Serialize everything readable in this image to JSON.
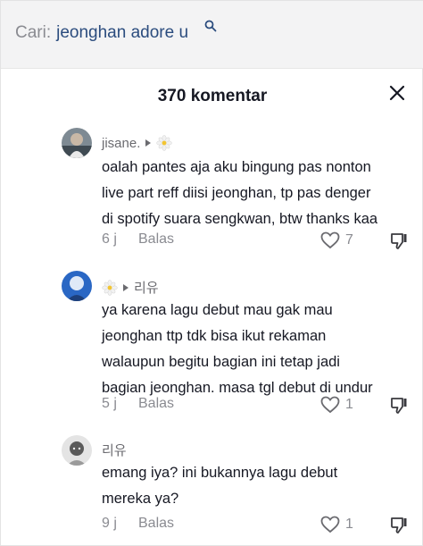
{
  "search": {
    "prefix": "Cari:",
    "query": "jeonghan adore u"
  },
  "sheet": {
    "title": "370 komentar"
  },
  "comments": [
    {
      "username": "jisane.",
      "reply_to": "",
      "lines": [
        "oalah pantes aja aku bingung pas nonton",
        "live part reff diisi jeonghan, tp pas denger",
        "di spotify suara sengkwan, btw thanks kaa"
      ],
      "time": "6 j",
      "reply_label": "Balas",
      "likes": "7"
    },
    {
      "username": "",
      "reply_to": "리유",
      "lines": [
        "ya karena lagu debut mau gak mau",
        "jeonghan ttp tdk bisa ikut rekaman",
        "walaupun begitu bagian ini tetap jadi",
        "bagian jeonghan. masa tgl debut di undur"
      ],
      "time": "5 j",
      "reply_label": "Balas",
      "likes": "1"
    },
    {
      "username": "리유",
      "reply_to": "",
      "lines": [
        "emang iya? ini bukannya lagu debut",
        "mereka ya?"
      ],
      "time": "9 j",
      "reply_label": "Balas",
      "likes": "1"
    }
  ],
  "colors": {
    "text": "#161823",
    "muted": "#8a8b91",
    "search_query": "#2b4c7e",
    "search_bg": "#f3f3f4"
  }
}
